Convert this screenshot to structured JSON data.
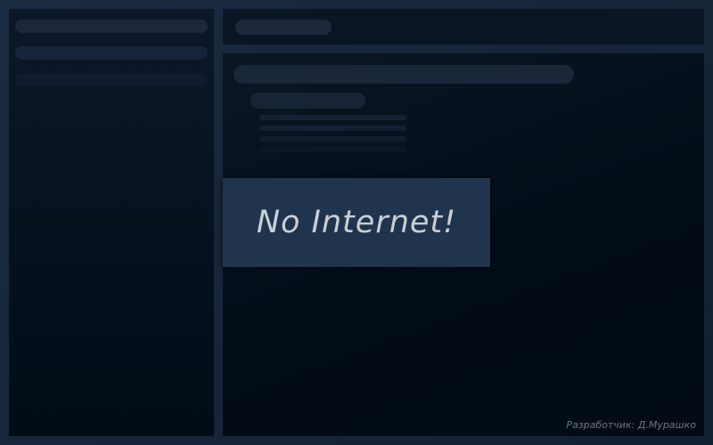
{
  "message": {
    "text": "No Internet!"
  },
  "footer": {
    "credit": "Разработчик: Д.Мурашко"
  },
  "colors": {
    "background": "#162338",
    "panel": "#020c16",
    "placeholder": "#1b283b",
    "toast_bg": "#21344d",
    "toast_text": "#c9cfd7",
    "credit_text": "#6a7584"
  }
}
